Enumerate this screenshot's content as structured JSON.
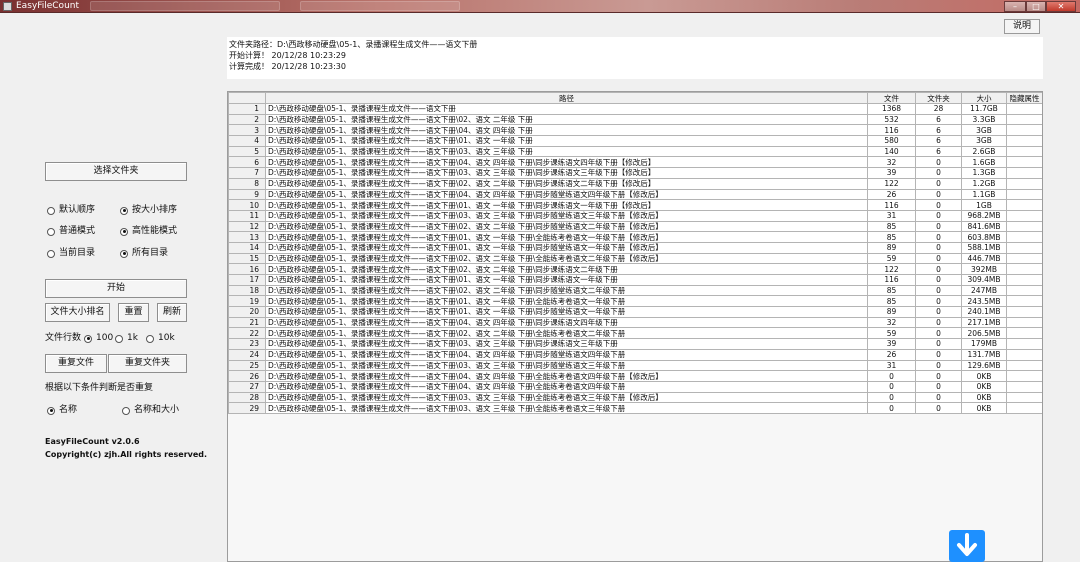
{
  "window": {
    "title": "EasyFileCount"
  },
  "help_button": "说明",
  "info": {
    "folder_path": "文件夹路径：D:\\西政移动硬盘\\05-1、录播课程生成文件——语文下册",
    "start_time": "开始计算！ 20/12/28 10:23:29",
    "end_time": "计算完成！ 20/12/28 10:23:30"
  },
  "left_panel": {
    "select_folder_button": "选择文件夹",
    "sort_options": [
      {
        "label": "默认顺序",
        "selected": false
      },
      {
        "label": "按大小排序",
        "selected": true
      }
    ],
    "mode_options": [
      {
        "label": "普通模式",
        "selected": false
      },
      {
        "label": "高性能模式",
        "selected": true
      }
    ],
    "scope_options": [
      {
        "label": "当前目录",
        "selected": false
      },
      {
        "label": "所有目录",
        "selected": true
      }
    ],
    "start_button": "开始",
    "file_size_rank_button": "文件大小排名",
    "reset_button": "重置",
    "refresh_button": "刷新",
    "file_lines_label": "文件行数",
    "file_lines_options": [
      {
        "label": "100",
        "selected": true
      },
      {
        "label": "1k",
        "selected": false
      },
      {
        "label": "10k",
        "selected": false
      }
    ],
    "duplicate_files_button": "重复文件",
    "duplicate_folders_button": "重复文件夹",
    "duplicate_condition_label": "根据以下条件判断是否重复",
    "duplicate_options": [
      {
        "label": "名称",
        "selected": true
      },
      {
        "label": "名称和大小",
        "selected": false
      }
    ],
    "version": "EasyFileCount v2.0.6",
    "copyright": "Copyright(c) zjh.All rights reserved."
  },
  "table": {
    "columns": [
      "",
      "路径",
      "文件",
      "文件夹",
      "大小",
      "隐藏属性"
    ],
    "rows": [
      [
        "1",
        "D:\\西政移动硬盘\\05-1、录播课程生成文件——语文下册",
        "1368",
        "28",
        "11.7GB",
        ""
      ],
      [
        "2",
        "D:\\西政移动硬盘\\05-1、录播课程生成文件——语文下册\\02、语文 二年级 下册",
        "532",
        "6",
        "3.3GB",
        ""
      ],
      [
        "3",
        "D:\\西政移动硬盘\\05-1、录播课程生成文件——语文下册\\04、语文 四年级 下册",
        "116",
        "6",
        "3GB",
        ""
      ],
      [
        "4",
        "D:\\西政移动硬盘\\05-1、录播课程生成文件——语文下册\\01、语文 一年级 下册",
        "580",
        "6",
        "3GB",
        ""
      ],
      [
        "5",
        "D:\\西政移动硬盘\\05-1、录播课程生成文件——语文下册\\03、语文 三年级 下册",
        "140",
        "6",
        "2.6GB",
        ""
      ],
      [
        "6",
        "D:\\西政移动硬盘\\05-1、录播课程生成文件——语文下册\\04、语文 四年级 下册\\同步课练语文四年级下册【修改后】",
        "32",
        "0",
        "1.6GB",
        ""
      ],
      [
        "7",
        "D:\\西政移动硬盘\\05-1、录播课程生成文件——语文下册\\03、语文 三年级 下册\\同步课练语文三年级下册【修改后】",
        "39",
        "0",
        "1.3GB",
        ""
      ],
      [
        "8",
        "D:\\西政移动硬盘\\05-1、录播课程生成文件——语文下册\\02、语文 二年级 下册\\同步课练语文二年级下册【修改后】",
        "122",
        "0",
        "1.2GB",
        ""
      ],
      [
        "9",
        "D:\\西政移动硬盘\\05-1、录播课程生成文件——语文下册\\04、语文 四年级 下册\\同步随堂练语文四年级下册【修改后】",
        "26",
        "0",
        "1.1GB",
        ""
      ],
      [
        "10",
        "D:\\西政移动硬盘\\05-1、录播课程生成文件——语文下册\\01、语文 一年级 下册\\同步课练语文一年级下册【修改后】",
        "116",
        "0",
        "1GB",
        ""
      ],
      [
        "11",
        "D:\\西政移动硬盘\\05-1、录播课程生成文件——语文下册\\03、语文 三年级 下册\\同步随堂练语文三年级下册【修改后】",
        "31",
        "0",
        "968.2MB",
        ""
      ],
      [
        "12",
        "D:\\西政移动硬盘\\05-1、录播课程生成文件——语文下册\\02、语文 二年级 下册\\同步随堂练语文二年级下册【修改后】",
        "85",
        "0",
        "841.6MB",
        ""
      ],
      [
        "13",
        "D:\\西政移动硬盘\\05-1、录播课程生成文件——语文下册\\01、语文 一年级 下册\\全能练考卷语文一年级下册【修改后】",
        "85",
        "0",
        "603.8MB",
        ""
      ],
      [
        "14",
        "D:\\西政移动硬盘\\05-1、录播课程生成文件——语文下册\\01、语文 一年级 下册\\同步随堂练语文一年级下册【修改后】",
        "89",
        "0",
        "588.1MB",
        ""
      ],
      [
        "15",
        "D:\\西政移动硬盘\\05-1、录播课程生成文件——语文下册\\02、语文 二年级 下册\\全能练考卷语文二年级下册【修改后】",
        "59",
        "0",
        "446.7MB",
        ""
      ],
      [
        "16",
        "D:\\西政移动硬盘\\05-1、录播课程生成文件——语文下册\\02、语文 二年级 下册\\同步课练语文二年级下册",
        "122",
        "0",
        "392MB",
        ""
      ],
      [
        "17",
        "D:\\西政移动硬盘\\05-1、录播课程生成文件——语文下册\\01、语文 一年级 下册\\同步课练语文一年级下册",
        "116",
        "0",
        "309.4MB",
        ""
      ],
      [
        "18",
        "D:\\西政移动硬盘\\05-1、录播课程生成文件——语文下册\\02、语文 二年级 下册\\同步随堂练语文二年级下册",
        "85",
        "0",
        "247MB",
        ""
      ],
      [
        "19",
        "D:\\西政移动硬盘\\05-1、录播课程生成文件——语文下册\\01、语文 一年级 下册\\全能练考卷语文一年级下册",
        "85",
        "0",
        "243.5MB",
        ""
      ],
      [
        "20",
        "D:\\西政移动硬盘\\05-1、录播课程生成文件——语文下册\\01、语文 一年级 下册\\同步随堂练语文一年级下册",
        "89",
        "0",
        "240.1MB",
        ""
      ],
      [
        "21",
        "D:\\西政移动硬盘\\05-1、录播课程生成文件——语文下册\\04、语文 四年级 下册\\同步课练语文四年级下册",
        "32",
        "0",
        "217.1MB",
        ""
      ],
      [
        "22",
        "D:\\西政移动硬盘\\05-1、录播课程生成文件——语文下册\\02、语文 二年级 下册\\全能练考卷语文二年级下册",
        "59",
        "0",
        "206.5MB",
        ""
      ],
      [
        "23",
        "D:\\西政移动硬盘\\05-1、录播课程生成文件——语文下册\\03、语文 三年级 下册\\同步课练语文三年级下册",
        "39",
        "0",
        "179MB",
        ""
      ],
      [
        "24",
        "D:\\西政移动硬盘\\05-1、录播课程生成文件——语文下册\\04、语文 四年级 下册\\同步随堂练语文四年级下册",
        "26",
        "0",
        "131.7MB",
        ""
      ],
      [
        "25",
        "D:\\西政移动硬盘\\05-1、录播课程生成文件——语文下册\\03、语文 三年级 下册\\同步随堂练语文三年级下册",
        "31",
        "0",
        "129.6MB",
        ""
      ],
      [
        "26",
        "D:\\西政移动硬盘\\05-1、录播课程生成文件——语文下册\\04、语文 四年级 下册\\全能练考卷语文四年级下册【修改后】",
        "0",
        "0",
        "0KB",
        ""
      ],
      [
        "27",
        "D:\\西政移动硬盘\\05-1、录播课程生成文件——语文下册\\04、语文 四年级 下册\\全能练考卷语文四年级下册",
        "0",
        "0",
        "0KB",
        ""
      ],
      [
        "28",
        "D:\\西政移动硬盘\\05-1、录播课程生成文件——语文下册\\03、语文 三年级 下册\\全能练考卷语文三年级下册【修改后】",
        "0",
        "0",
        "0KB",
        ""
      ],
      [
        "29",
        "D:\\西政移动硬盘\\05-1、录播课程生成文件——语文下册\\03、语文 三年级 下册\\全能练考卷语文三年级下册",
        "0",
        "0",
        "0KB",
        ""
      ]
    ]
  },
  "icons": {
    "app": "app-icon",
    "scroll_down": "download-arrow-icon",
    "accent": "#1e90ff"
  }
}
